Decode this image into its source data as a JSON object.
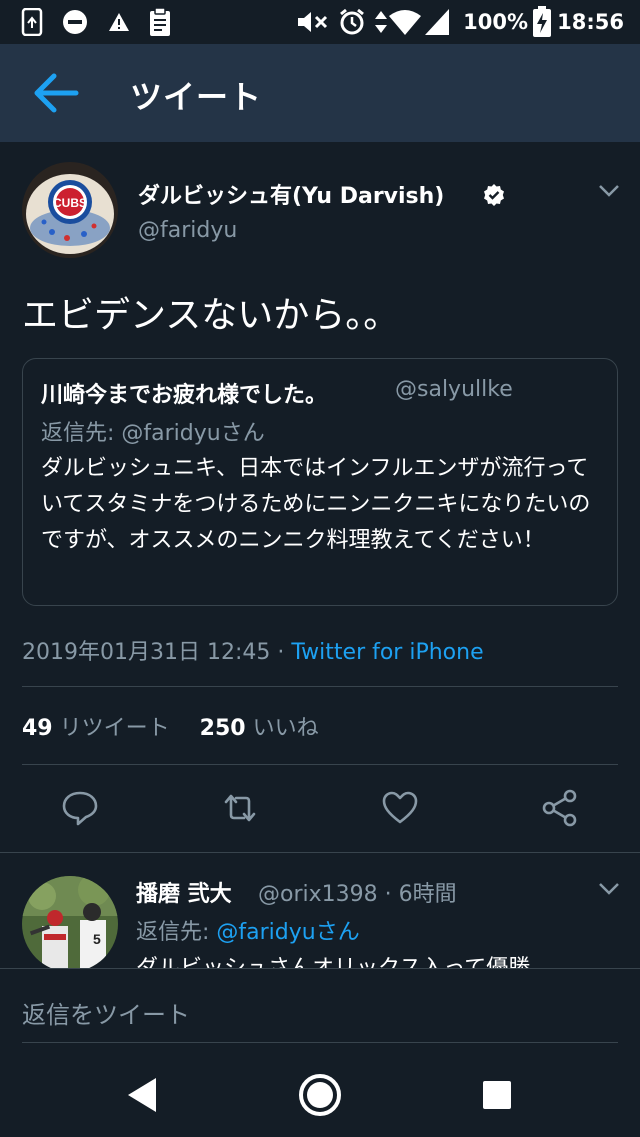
{
  "status_bar": {
    "battery_percent": "100%",
    "time": "18:56",
    "icons": [
      "screen-rotate-icon",
      "do-not-disturb-icon",
      "warning-icon",
      "clipboard-icon",
      "mute-icon",
      "alarm-icon",
      "data-arrows-icon",
      "wifi-icon",
      "cell-signal-icon",
      "battery-charging-icon"
    ]
  },
  "header": {
    "title": "ツイート"
  },
  "tweet": {
    "author_name": "ダルビッシュ有(Yu Darvish)",
    "handle": "@faridyu",
    "text": "エビデンスないから。。",
    "avatar_text": "CUBS",
    "quote": {
      "author_name": "川崎今までお疲れ様でした。",
      "handle": "@salyullke",
      "reply_to": "返信先: @faridyuさん",
      "text": "ダルビッシュニキ、日本ではインフルエンザが流行っていてスタミナをつけるためにニンニクニキになりたいのですが、オススメのニンニク料理教えてください！"
    },
    "timestamp": "2019年01月31日 12:45",
    "separator": "·",
    "source": "Twitter for iPhone",
    "retweet_count": "49",
    "retweet_label": "リツイート",
    "like_count": "250",
    "like_label": "いいね"
  },
  "reply": {
    "author_name": "播磨 弐大",
    "handle_time": "@orix1398 · 6時間",
    "reply_prefix": "返信先: ",
    "reply_to": "@faridyuさん",
    "text": "ダルビッシュさんオリックス入って優勝"
  },
  "compose": {
    "placeholder": "返信をツイート"
  },
  "colors": {
    "background": "#141d26",
    "header_bg": "#243447",
    "accent": "#1da1f2",
    "secondary_text": "#8899a6",
    "border": "#38444d"
  }
}
